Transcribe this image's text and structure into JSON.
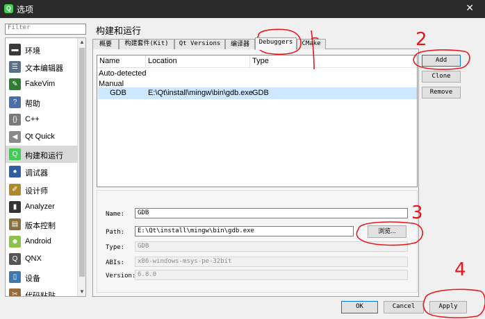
{
  "window": {
    "title": "选项",
    "close_glyph": "✕"
  },
  "filter": {
    "placeholder": "Filter"
  },
  "sidebar": {
    "items": [
      {
        "label": "环境",
        "icon": "monitor-icon",
        "color": "#3a3a3a"
      },
      {
        "label": "文本编辑器",
        "icon": "text-editor-icon",
        "color": "#5a6f8a"
      },
      {
        "label": "FakeVim",
        "icon": "fakevim-icon",
        "color": "#2e7d32"
      },
      {
        "label": "帮助",
        "icon": "help-icon",
        "color": "#4a6ea9"
      },
      {
        "label": "C++",
        "icon": "cpp-icon",
        "color": "#7a7a7a"
      },
      {
        "label": "Qt Quick",
        "icon": "qt-quick-icon",
        "color": "#8a8a8a"
      },
      {
        "label": "构建和运行",
        "icon": "build-run-icon",
        "color": "#41cd52"
      },
      {
        "label": "调试器",
        "icon": "debugger-icon",
        "color": "#2f5f9f"
      },
      {
        "label": "设计师",
        "icon": "designer-icon",
        "color": "#b08a2a"
      },
      {
        "label": "Analyzer",
        "icon": "analyzer-icon",
        "color": "#333333"
      },
      {
        "label": "版本控制",
        "icon": "version-control-icon",
        "color": "#8b6f3a"
      },
      {
        "label": "Android",
        "icon": "android-icon",
        "color": "#8bc34a"
      },
      {
        "label": "QNX",
        "icon": "qnx-icon",
        "color": "#555555"
      },
      {
        "label": "设备",
        "icon": "device-icon",
        "color": "#3f78b0"
      },
      {
        "label": "代码粘贴",
        "icon": "code-paste-icon",
        "color": "#9a6b3a"
      }
    ],
    "selected_index": 6
  },
  "page": {
    "title": "构建和运行"
  },
  "tabs": [
    {
      "label": "概要"
    },
    {
      "label": "构建套件(Kit)"
    },
    {
      "label": "Qt Versions"
    },
    {
      "label": "编译器"
    },
    {
      "label": "Debuggers"
    },
    {
      "label": "CMake"
    }
  ],
  "tree": {
    "columns": [
      "Name",
      "Location",
      "Type"
    ],
    "groups": [
      "Auto-detected",
      "Manual"
    ],
    "selected": {
      "name": "GDB",
      "location": "E:\\Qt\\install\\mingw\\bin\\gdb.exe",
      "type": "GDB"
    },
    "selection_color": "#cde8ff"
  },
  "side_buttons": {
    "add": "Add",
    "clone": "Clone",
    "remove": "Remove"
  },
  "details": {
    "name_label": "Name:",
    "name_value": "GDB",
    "path_label": "Path:",
    "path_value": "E:\\Qt\\install\\mingw\\bin\\gdb.exe",
    "browse_label": "浏览...",
    "type_label": "Type:",
    "type_value": "GDB",
    "abis_label": "ABIs:",
    "abis_value": "x86-windows-msys-pe-32bit",
    "version_label": "Version:",
    "version_value": "6.8.0"
  },
  "dialog_buttons": {
    "ok": "OK",
    "cancel": "Cancel",
    "apply": "Apply"
  },
  "annotations": {
    "color": "#e8161c",
    "numbers": [
      "1",
      "2",
      "3",
      "4"
    ]
  }
}
